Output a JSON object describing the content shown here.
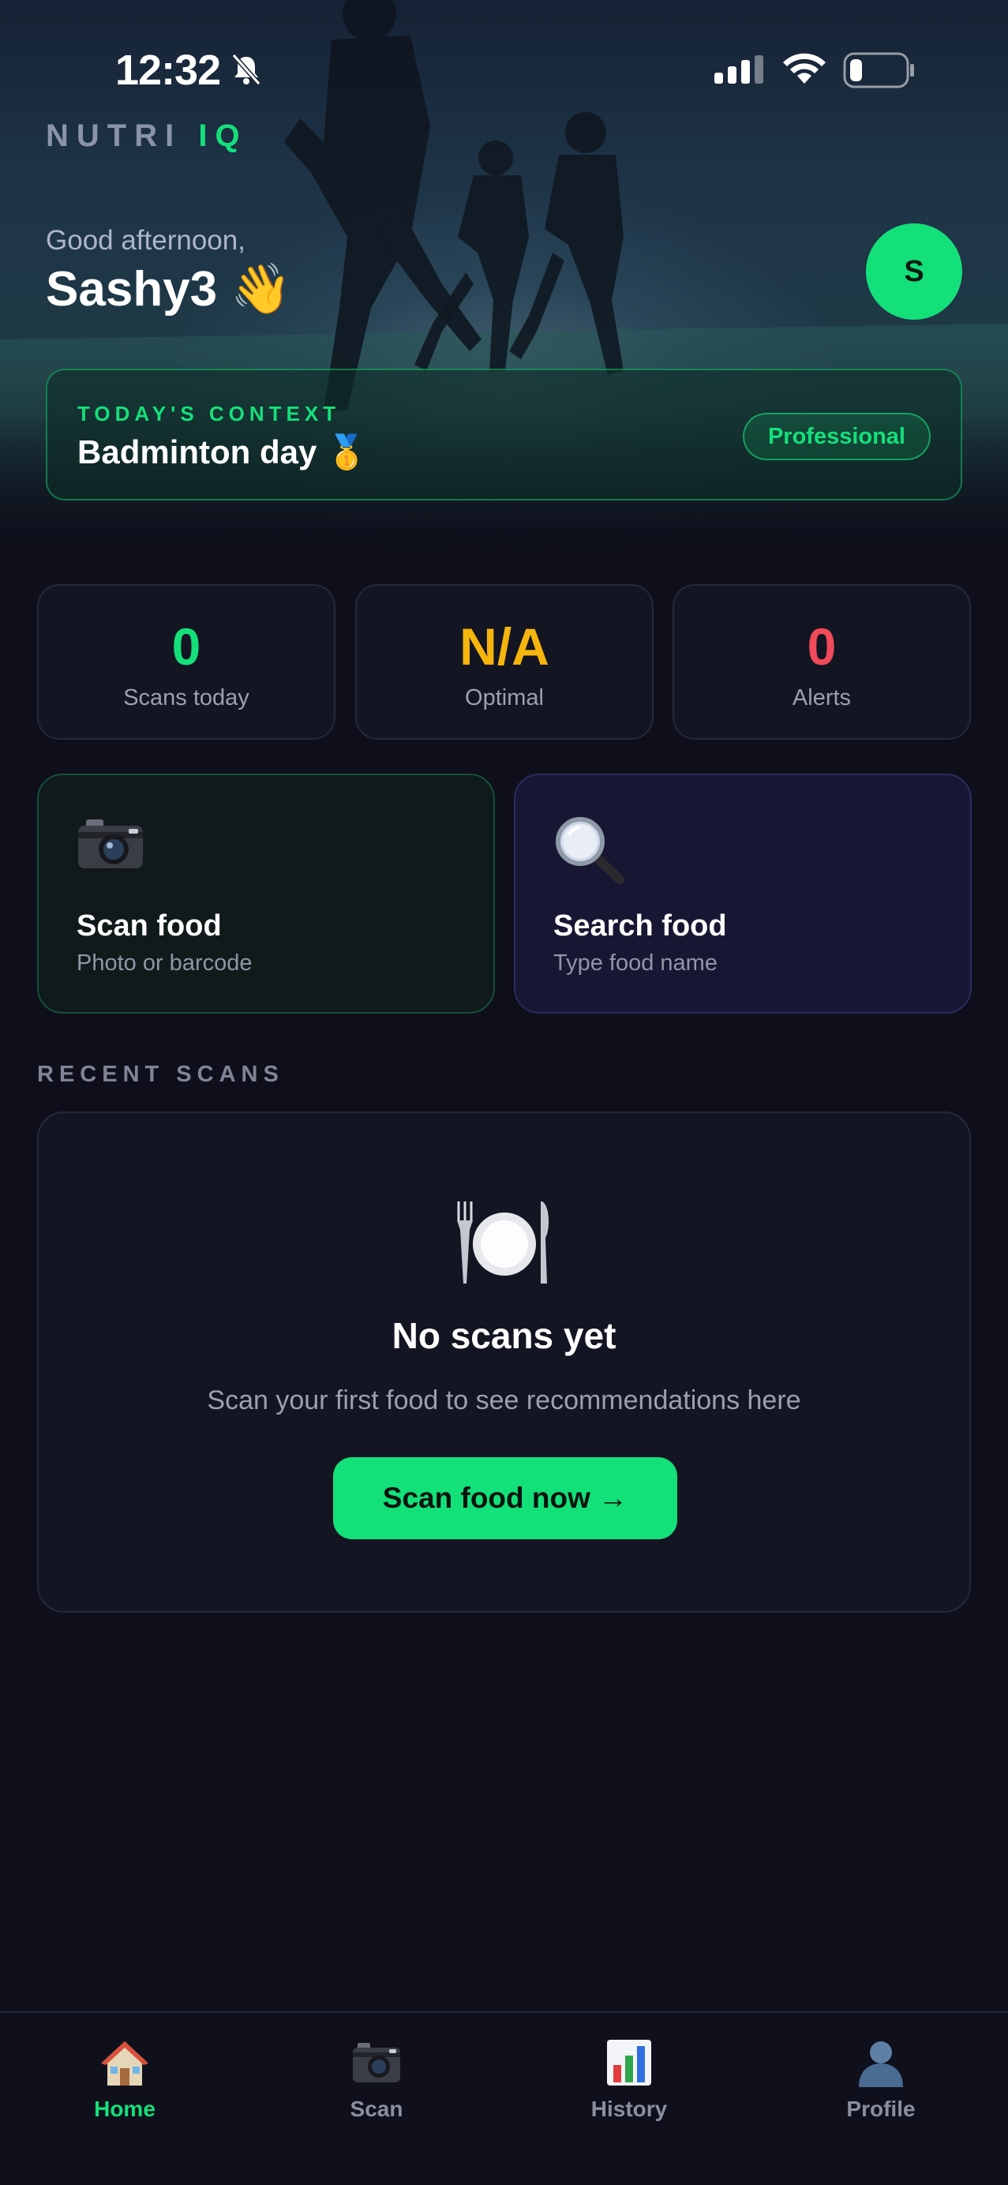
{
  "status_bar": {
    "time": "12:32"
  },
  "brand": {
    "primary": "NUTRI",
    "accent": "IQ"
  },
  "greeting": {
    "salutation": "Good afternoon,",
    "name": "Sashy3 👋"
  },
  "avatar": {
    "initial": "S"
  },
  "context": {
    "label": "TODAY'S CONTEXT",
    "value": "Badminton day 🥇",
    "badge": "Professional"
  },
  "stats": [
    {
      "value": "0",
      "label": "Scans today",
      "color": "#14e07a"
    },
    {
      "value": "N/A",
      "label": "Optimal",
      "color": "#f5b50c"
    },
    {
      "value": "0",
      "label": "Alerts",
      "color": "#f14a5a"
    }
  ],
  "actions": {
    "scan": {
      "title": "Scan food",
      "subtitle": "Photo or barcode",
      "icon": "camera-icon"
    },
    "search": {
      "title": "Search food",
      "subtitle": "Type food name",
      "icon": "magnifier-icon"
    }
  },
  "recent": {
    "label": "RECENT SCANS",
    "empty_icon": "plate-cutlery-icon",
    "empty_title": "No scans yet",
    "empty_subtitle": "Scan your first food to see recommendations here",
    "cta": "Scan food now →"
  },
  "tabs": [
    {
      "label": "Home",
      "icon": "house-icon",
      "active": true
    },
    {
      "label": "Scan",
      "icon": "camera-icon",
      "active": false
    },
    {
      "label": "History",
      "icon": "bar-chart-icon",
      "active": false
    },
    {
      "label": "Profile",
      "icon": "person-icon",
      "active": false
    }
  ],
  "colors": {
    "accent": "#14e07a",
    "background": "#0e0f1b",
    "card": "#141522"
  }
}
